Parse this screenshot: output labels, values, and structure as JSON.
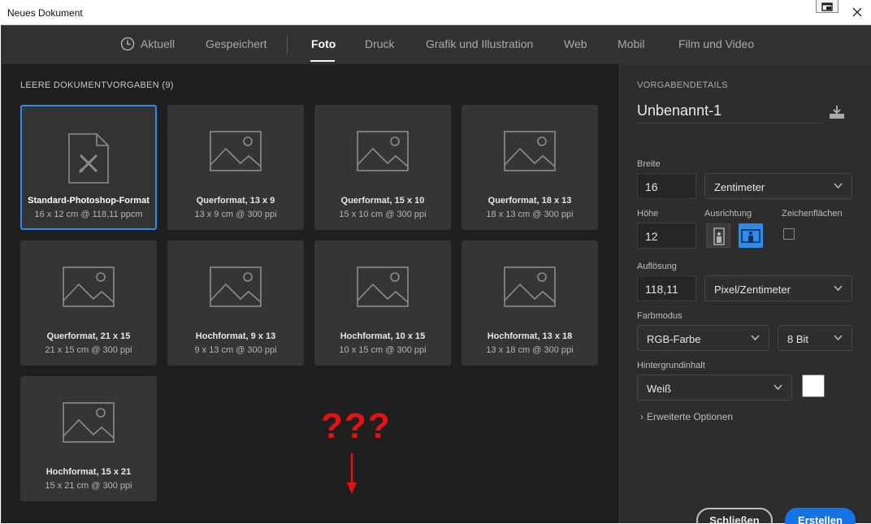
{
  "window": {
    "title": "Neues Dokument"
  },
  "tabs": [
    {
      "label": "Aktuell"
    },
    {
      "label": "Gespeichert"
    },
    {
      "label": "Foto"
    },
    {
      "label": "Druck"
    },
    {
      "label": "Grafik und Illustration"
    },
    {
      "label": "Web"
    },
    {
      "label": "Mobil"
    },
    {
      "label": "Film und Video"
    }
  ],
  "presets": {
    "heading": "LEERE DOKUMENTVORGABEN  (9)",
    "items": [
      {
        "name": "Standard-Photoshop-Format",
        "sub": "16 x 12 cm @ 118,11 ppcm"
      },
      {
        "name": "Querformat, 13 x 9",
        "sub": "13 x 9 cm @ 300 ppi"
      },
      {
        "name": "Querformat, 15 x 10",
        "sub": "15 x 10 cm @ 300 ppi"
      },
      {
        "name": "Querformat, 18 x 13",
        "sub": "18 x 13 cm @ 300 ppi"
      },
      {
        "name": "Querformat, 21 x 15",
        "sub": "21 x 15 cm @ 300 ppi"
      },
      {
        "name": "Hochformat, 9 x 13",
        "sub": "9 x 13 cm @ 300 ppi"
      },
      {
        "name": "Hochformat, 10 x 15",
        "sub": "10 x 15 cm @ 300 ppi"
      },
      {
        "name": "Hochformat, 13 x 18",
        "sub": "13 x 18 cm @ 300 ppi"
      },
      {
        "name": "Hochformat, 15 x 21",
        "sub": "15 x 21 cm @ 300 ppi"
      }
    ],
    "annotation": "???"
  },
  "details": {
    "heading": "VORGABENDETAILS",
    "doc_name": "Unbenannt-1",
    "width_label": "Breite",
    "width_value": "16",
    "width_unit": "Zentimeter",
    "height_label": "Höhe",
    "height_value": "12",
    "orientation_label": "Ausrichtung",
    "artboards_label": "Zeichenflächen",
    "resolution_label": "Auflösung",
    "resolution_value": "118,11",
    "resolution_unit": "Pixel/Zentimeter",
    "colormode_label": "Farbmodus",
    "colormode_value": "RGB-Farbe",
    "bitdepth_value": "8 Bit",
    "background_label": "Hintergrundinhalt",
    "background_value": "Weiß",
    "background_color": "#ffffff",
    "advanced_label": "Erweiterte Optionen",
    "close_label": "Schließen",
    "create_label": "Erstellen"
  },
  "colors": {
    "accent": "#1473e6",
    "selection": "#2d8ceb",
    "annotation": "#e81010"
  }
}
